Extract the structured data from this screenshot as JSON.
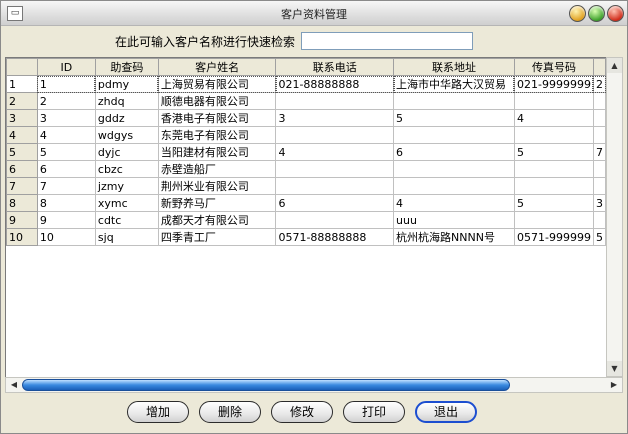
{
  "window": {
    "title": "客户资料管理"
  },
  "search": {
    "label": "在此可输入客户名称进行快速检索",
    "value": ""
  },
  "grid": {
    "columns": [
      {
        "label": "",
        "w": 32
      },
      {
        "label": "ID",
        "w": 64
      },
      {
        "label": "助查码",
        "w": 66
      },
      {
        "label": "客户姓名",
        "w": 121
      },
      {
        "label": "联系电话",
        "w": 121
      },
      {
        "label": "联系地址",
        "w": 121
      },
      {
        "label": "传真号码",
        "w": 67
      },
      {
        "label": "",
        "w": 8
      }
    ],
    "rows": [
      [
        "1",
        "1",
        "pdmy",
        "上海贸易有限公司",
        "021-88888888",
        "上海市中华路大汉贸易",
        "021-9999999",
        "2"
      ],
      [
        "2",
        "2",
        "zhdq",
        "顺德电器有限公司",
        "",
        "",
        "",
        ""
      ],
      [
        "3",
        "3",
        "gddz",
        "香港电子有限公司",
        "3",
        "5",
        "4",
        ""
      ],
      [
        "4",
        "4",
        "wdgys",
        "东莞电子有限公司",
        "",
        "",
        "",
        ""
      ],
      [
        "5",
        "5",
        "dyjc",
        "当阳建材有限公司",
        "4",
        "6",
        "5",
        "7"
      ],
      [
        "6",
        "6",
        "cbzc",
        "赤壁造船厂",
        "",
        "",
        "",
        ""
      ],
      [
        "7",
        "7",
        "jzmy",
        "荆州米业有限公司",
        "",
        "",
        "",
        ""
      ],
      [
        "8",
        "8",
        "xymc",
        "新野养马厂",
        "6",
        "4",
        "5",
        "3"
      ],
      [
        "9",
        "9",
        "cdtc",
        "成都天才有限公司",
        "",
        "uuu",
        "",
        ""
      ],
      [
        "10",
        "10",
        "sjq",
        "四季青工厂",
        "0571-88888888",
        "杭州杭海路NNNN号",
        "0571-999999",
        "5"
      ]
    ]
  },
  "buttons": {
    "add": "增加",
    "delete": "删除",
    "edit": "修改",
    "print": "打印",
    "exit": "退出"
  }
}
